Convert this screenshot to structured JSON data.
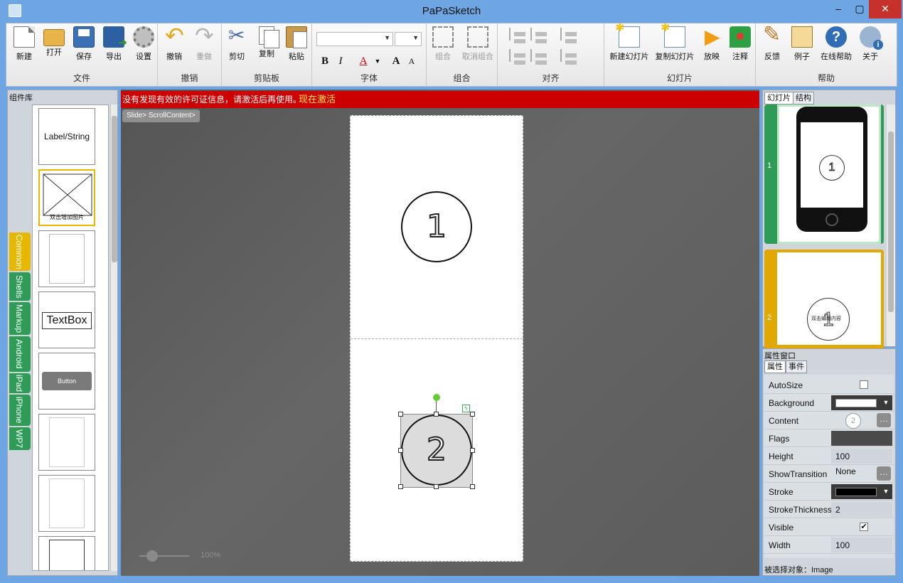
{
  "window": {
    "title": "PaPaSketch"
  },
  "ribbon": {
    "groups": {
      "file": "文件",
      "undo": "撤销",
      "clipboard": "剪贴板",
      "font": "字体",
      "combine": "组合",
      "align": "对齐",
      "slides": "幻灯片",
      "help": "帮助"
    },
    "buttons": {
      "new": "新建",
      "open": "打开",
      "save": "保存",
      "export": "导出",
      "settings": "设置",
      "undo": "撤销",
      "redo": "重做",
      "cut": "剪切",
      "copy": "复制",
      "paste": "粘贴",
      "group": "组合",
      "ungroup": "取消组合",
      "new_slide": "新建幻灯片",
      "copy_slide": "复制幻灯片",
      "play": "放映",
      "annotate": "注释",
      "feedback": "反馈",
      "examples": "例子",
      "online_help": "在线帮助",
      "about": "关于"
    },
    "format": {
      "bold": "B",
      "italic": "I",
      "font_color": "A",
      "grow": "A",
      "shrink": "A"
    }
  },
  "library": {
    "title": "组件库",
    "tabs": [
      "Common",
      "Shells",
      "Markup",
      "Android",
      "iPad",
      "iPhone",
      "WP7"
    ],
    "items": [
      "Label/String",
      "双击增加图片",
      "",
      "TextBox",
      "Button",
      "",
      "",
      ""
    ]
  },
  "canvas": {
    "notice": "没有发现有效的许可证信息，请激活后再使用。",
    "activate_link": "现在激活",
    "breadcrumb": "Slide> ScrollContent>",
    "circle1": "1",
    "circle2": "2",
    "zoom": "100%"
  },
  "slides_panel": {
    "tabs": [
      "幻灯片",
      "结构"
    ],
    "slides": [
      {
        "num": "1",
        "digit": "1"
      },
      {
        "num": "2",
        "digit": "1",
        "caption": "双击编辑内容"
      }
    ]
  },
  "props_panel": {
    "title": "属性窗口",
    "tabs": [
      "属性",
      "事件"
    ],
    "rows": [
      {
        "name": "AutoSize",
        "value": ""
      },
      {
        "name": "Background",
        "value": ""
      },
      {
        "name": "Content",
        "value": "2"
      },
      {
        "name": "Flags",
        "value": ""
      },
      {
        "name": "Height",
        "value": "100"
      },
      {
        "name": "ShowTransition",
        "value": "None"
      },
      {
        "name": "Stroke",
        "value": ""
      },
      {
        "name": "StrokeThickness",
        "value": "2"
      },
      {
        "name": "Visible",
        "value": "✔"
      },
      {
        "name": "Width",
        "value": "100"
      }
    ],
    "selected": "被选择对象：Image"
  },
  "colors": {
    "titlebar": "#6ea6e4",
    "notice_bg": "#cc0000",
    "activate": "#ffe84d",
    "tab_common": "#e6b800",
    "tab_other": "#2e9b57",
    "slide1_frame": "#2e9b57",
    "slide2_frame": "#e0a800",
    "stroke": "#000000",
    "background": "#ffffff"
  }
}
